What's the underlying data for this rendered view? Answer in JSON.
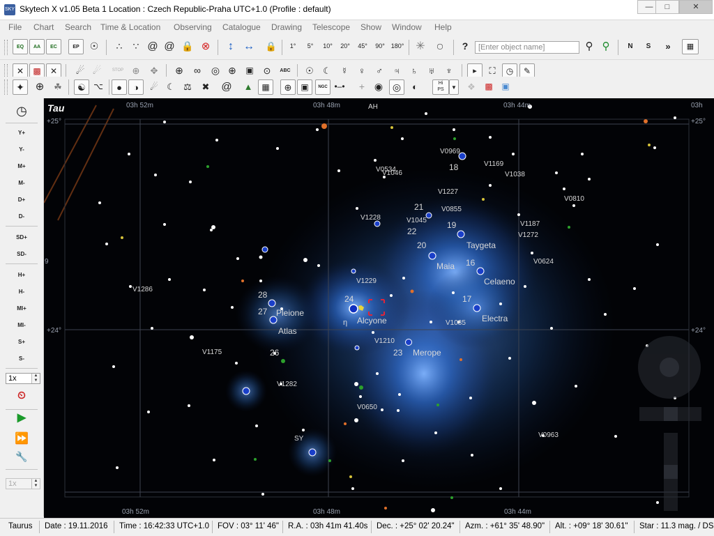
{
  "window": {
    "title": "Skytech X v1.05 Beta 1   Location : Czech Republic-Praha  UTC+1.0 (Profile : default)"
  },
  "menu": [
    "File",
    "Chart",
    "Search",
    "Time & Location",
    "Observing",
    "Catalogue",
    "Drawing",
    "Telescope",
    "Show",
    "Window",
    "Help"
  ],
  "toolbar1": {
    "proj_eq": "EQ",
    "proj_aa": "AA",
    "proj_ec": "EC",
    "epoch": "EP",
    "fov_labels": [
      "1°",
      "5°",
      "10°",
      "20°",
      "45°",
      "90°",
      "180°"
    ],
    "help": "?",
    "search_placeholder": "[Enter object name]",
    "north": "N",
    "south": "S",
    "more": "»"
  },
  "toolbar2": {
    "stop": "STOP",
    "abc": "ABC",
    "more": "»"
  },
  "toolbar3": {
    "hips": "Hi\nPS",
    "ngc": "NGC"
  },
  "left_panel": {
    "buttons": [
      "Y+",
      "Y-",
      "M+",
      "M-",
      "D+",
      "D-",
      "SD+",
      "SD-",
      "H+",
      "H-",
      "MI+",
      "MI-",
      "S+",
      "S-"
    ],
    "step1": "1x",
    "step2": "1x"
  },
  "chart": {
    "constellation": "Tau",
    "ra_top": [
      "03h 52m",
      "03h 48m",
      "03h 44m",
      "03h"
    ],
    "ra_bottom": [
      "03h 52m",
      "03h 48m",
      "03h 44m"
    ],
    "dec_labels": [
      "+25°",
      "+25°",
      "+24°",
      "+24°"
    ],
    "left_edge_label": "9",
    "labels": [
      "AH",
      "V0969",
      "18",
      "V1169",
      "V0534",
      "V1046",
      "V1038",
      "V1227",
      "V0810",
      "21",
      "V0855",
      "V1228",
      "V1045",
      "22",
      "19",
      "V1187",
      "V1272",
      "Taygeta",
      "20",
      "Maia",
      "16",
      "V0624",
      "Celaeno",
      "V1229",
      "V1286",
      "28",
      "24",
      "17",
      "27",
      "Pleione",
      "η",
      "Alcyone",
      "V1085",
      "Electra",
      "Atlas",
      "V1210",
      "V1175",
      "26",
      "23",
      "Merope",
      "V1282",
      "V0650",
      "SY",
      "V0963"
    ]
  },
  "status": {
    "constellation": "Taurus",
    "date": "Date : 19.11.2016",
    "time": "Time : 16:42:33 UTC+1.0",
    "fov": "FOV : 03° 11' 46\"",
    "ra": "R.A. : 03h 41m 41.40s",
    "dec": "Dec. : +25° 02' 20.24\"",
    "azm": "Azm. : +61° 35' 48.90\"",
    "alt": "Alt. : +09° 18' 30.61\"",
    "star": "Star : 11.3 mag. / DS"
  },
  "colors": {
    "chart_bg": "#020306",
    "nebula": "#2a6dd6",
    "grid": "#3a3f4a",
    "label": "#d6d6d6"
  }
}
